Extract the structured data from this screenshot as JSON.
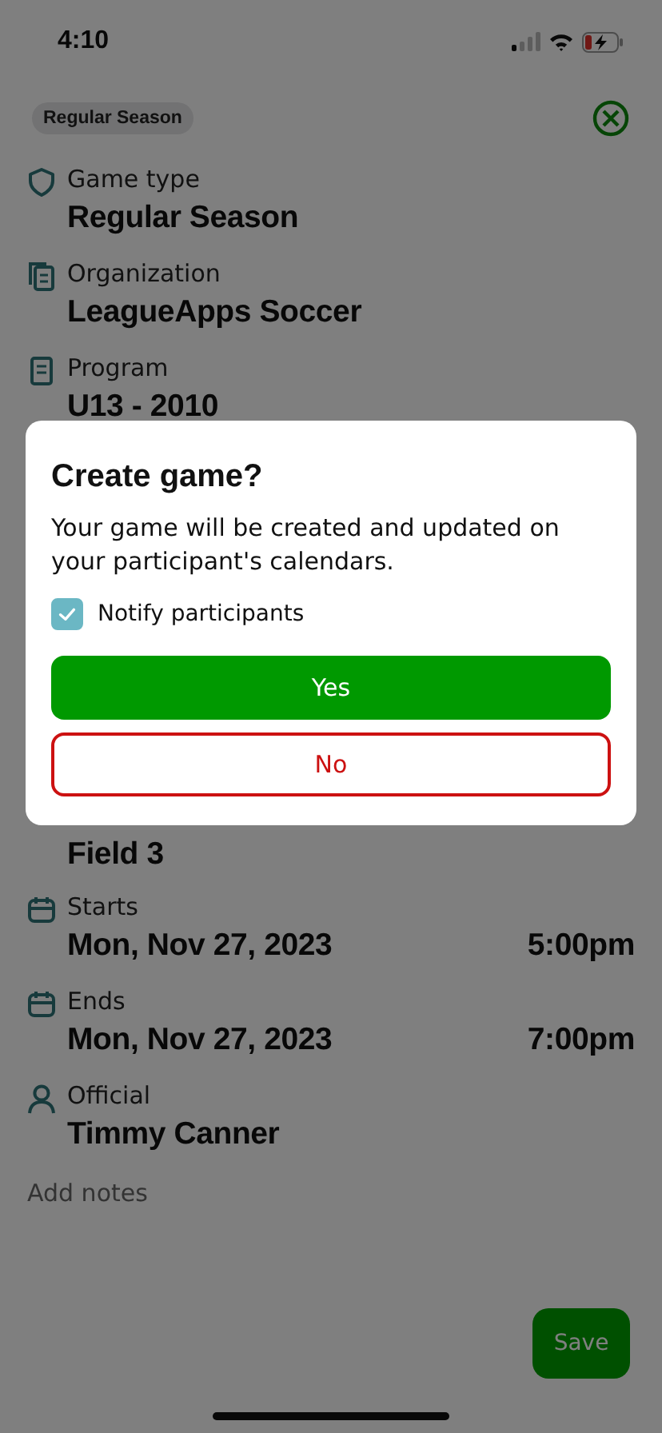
{
  "status_bar": {
    "time": "4:10"
  },
  "header": {
    "chip": "Regular Season"
  },
  "details_top": [
    {
      "label": "Game type",
      "value": "Regular Season"
    },
    {
      "label": "Organization",
      "value": "LeagueApps Soccer"
    },
    {
      "label": "Program",
      "value": "U13 - 2010"
    }
  ],
  "details_bottom": [
    {
      "value": "Field 3"
    },
    {
      "label": "Starts",
      "value": "Mon, Nov 27, 2023",
      "time": "5:00pm"
    },
    {
      "label": "Ends",
      "value": "Mon, Nov 27, 2023",
      "time": "7:00pm"
    },
    {
      "label": "Official",
      "value": "Timmy Canner"
    }
  ],
  "notes": {
    "placeholder": "Add notes"
  },
  "save_button": "Save",
  "dialog": {
    "title": "Create game?",
    "message": "Your game will be created and updated on your participant's calendars.",
    "checkbox": {
      "label": "Notify participants",
      "checked": true
    },
    "buttons": [
      {
        "kind": "primary",
        "label": "Yes"
      },
      {
        "kind": "danger",
        "label": "No"
      }
    ]
  }
}
